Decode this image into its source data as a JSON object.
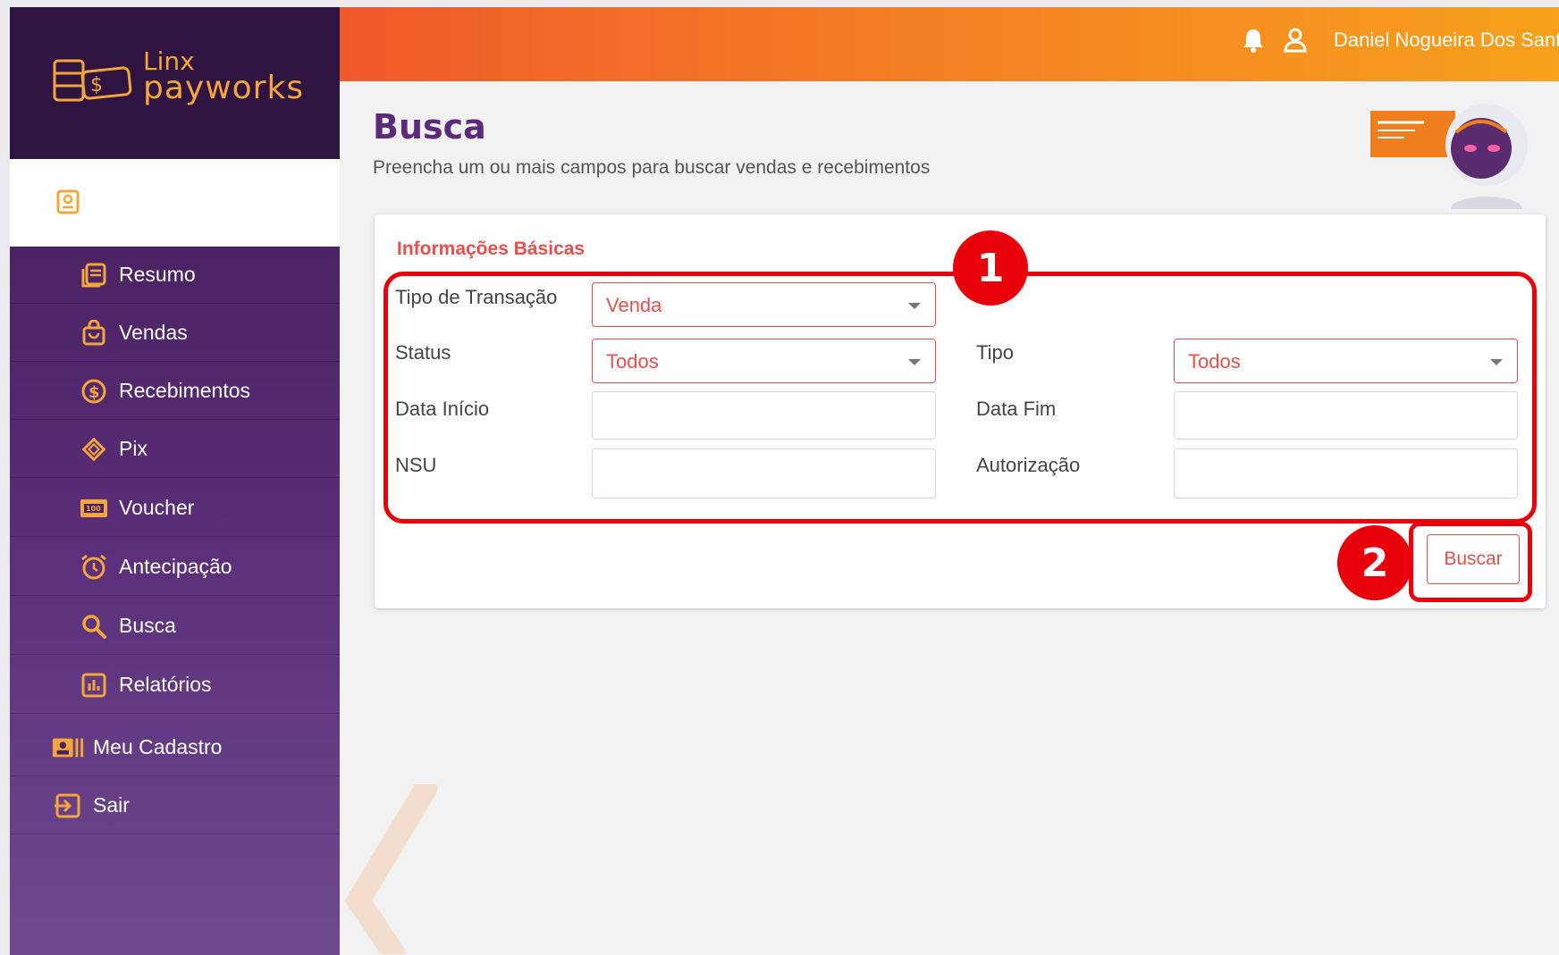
{
  "brand": {
    "line1": "Linx",
    "line2": "payworks"
  },
  "header": {
    "user_name": "Daniel Nogueira Dos Santos"
  },
  "sidebar": {
    "items": [
      {
        "label": "Resumo",
        "icon": "summary-icon"
      },
      {
        "label": "Vendas",
        "icon": "shopping-bag-icon"
      },
      {
        "label": "Recebimentos",
        "icon": "dollar-circle-icon"
      },
      {
        "label": "Pix",
        "icon": "pix-icon"
      },
      {
        "label": "Voucher",
        "icon": "voucher-icon"
      },
      {
        "label": "Antecipação",
        "icon": "alarm-clock-icon"
      },
      {
        "label": "Busca",
        "icon": "search-icon"
      },
      {
        "label": "Relatórios",
        "icon": "report-icon"
      },
      {
        "label": "Meu Cadastro",
        "icon": "id-card-icon"
      },
      {
        "label": "Sair",
        "icon": "logout-icon"
      }
    ]
  },
  "page": {
    "title": "Busca",
    "subtitle": "Preencha um ou mais campos para buscar vendas e recebimentos"
  },
  "form": {
    "section_title": "Informações Básicas",
    "tipo_transacao": {
      "label": "Tipo de Transação",
      "value": "Venda"
    },
    "status": {
      "label": "Status",
      "value": "Todos"
    },
    "tipo": {
      "label": "Tipo",
      "value": "Todos"
    },
    "data_inicio": {
      "label": "Data Início",
      "value": ""
    },
    "data_fim": {
      "label": "Data Fim",
      "value": ""
    },
    "nsu": {
      "label": "NSU",
      "value": ""
    },
    "autorizacao": {
      "label": "Autorização",
      "value": ""
    },
    "submit_label": "Buscar"
  },
  "annotations": {
    "one": "1",
    "two": "2"
  },
  "colors": {
    "accent": "#e3504d",
    "sidebar": "#4a2263",
    "header_start": "#ef5a2a",
    "header_end": "#f7a11c",
    "annotation": "#e8000b"
  }
}
